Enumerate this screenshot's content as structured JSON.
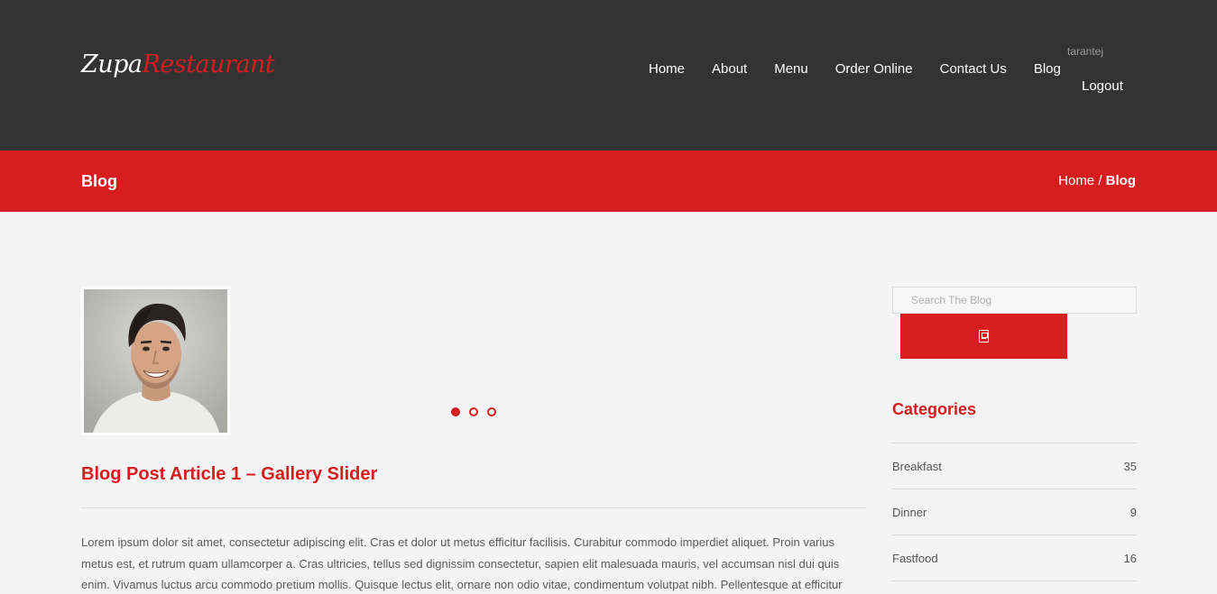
{
  "header": {
    "logo": {
      "part1": "Zupa",
      "part2": "Restaurant"
    },
    "nav": [
      {
        "label": "Home"
      },
      {
        "label": "About"
      },
      {
        "label": "Menu"
      },
      {
        "label": "Order Online"
      },
      {
        "label": "Contact Us"
      },
      {
        "label": "Blog"
      }
    ],
    "user": {
      "username": "tarantej",
      "logout_label": "Logout"
    }
  },
  "titlebar": {
    "title": "Blog",
    "breadcrumb": {
      "home": "Home",
      "separator": " / ",
      "current": "Blog"
    }
  },
  "post": {
    "image_icon": "portrait-photo",
    "slider": {
      "dot_count": 3,
      "active_index": 0
    },
    "title": "Blog Post Article 1 – Gallery Slider",
    "excerpt": "Lorem ipsum dolor sit amet, consectetur adipiscing elit. Cras et dolor ut metus efficitur facilisis. Curabitur commodo imperdiet aliquet. Proin varius metus est, et rutrum quam ullamcorper a. Cras ultricies, tellus sed dignissim consectetur, sapien elit malesuada mauris, vel accumsan nisl dui quis enim. Vivamus luctus arcu commodo pretium mollis. Quisque lectus elit, ornare non odio vitae, condimentum volutpat nibh. Pellentesque at efficitur"
  },
  "sidebar": {
    "search": {
      "placeholder": "Search The Blog",
      "button_icon": "search-icon"
    },
    "categories": {
      "heading": "Categories",
      "items": [
        {
          "label": "Breakfast",
          "count": "35"
        },
        {
          "label": "Dinner",
          "count": "9"
        },
        {
          "label": "Fastfood",
          "count": "16"
        }
      ]
    }
  },
  "colors": {
    "accent": "#d71d1e",
    "header_bg": "#333333",
    "page_bg": "#f4f4f4"
  }
}
